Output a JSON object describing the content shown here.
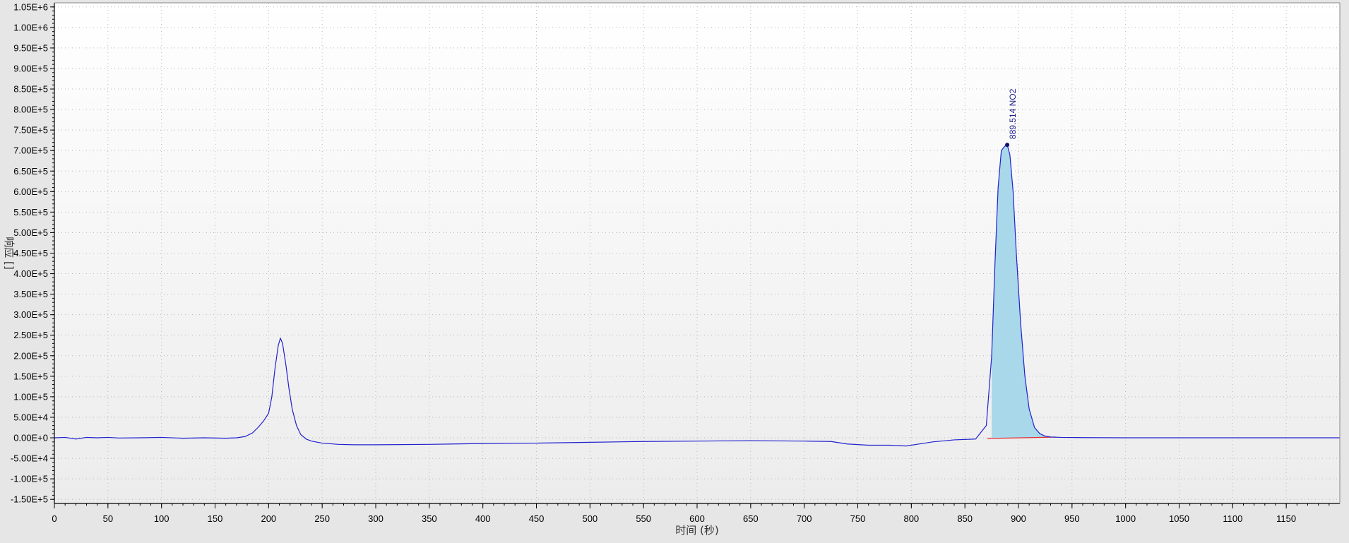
{
  "chart_data": {
    "type": "line",
    "xlabel": "时间 (秒)",
    "ylabel": "响应 []",
    "xlim": [
      0,
      1200
    ],
    "ylim": [
      -160000,
      1060000
    ],
    "x_ticks": [
      {
        "value": 0,
        "label": "0"
      },
      {
        "value": 50,
        "label": "50"
      },
      {
        "value": 100,
        "label": "100"
      },
      {
        "value": 150,
        "label": "150"
      },
      {
        "value": 200,
        "label": "200"
      },
      {
        "value": 250,
        "label": "250"
      },
      {
        "value": 300,
        "label": "300"
      },
      {
        "value": 350,
        "label": "350"
      },
      {
        "value": 400,
        "label": "400"
      },
      {
        "value": 450,
        "label": "450"
      },
      {
        "value": 500,
        "label": "500"
      },
      {
        "value": 550,
        "label": "550"
      },
      {
        "value": 600,
        "label": "600"
      },
      {
        "value": 650,
        "label": "650"
      },
      {
        "value": 700,
        "label": "700"
      },
      {
        "value": 750,
        "label": "750"
      },
      {
        "value": 800,
        "label": "800"
      },
      {
        "value": 850,
        "label": "850"
      },
      {
        "value": 900,
        "label": "900"
      },
      {
        "value": 950,
        "label": "950"
      },
      {
        "value": 1000,
        "label": "1000"
      },
      {
        "value": 1050,
        "label": "1050"
      },
      {
        "value": 1100,
        "label": "1100"
      },
      {
        "value": 1150,
        "label": "1150"
      }
    ],
    "y_ticks": [
      {
        "value": 1050000,
        "label": "1.05E+6"
      },
      {
        "value": 1000000,
        "label": "1.00E+6"
      },
      {
        "value": 950000,
        "label": "9.50E+5"
      },
      {
        "value": 900000,
        "label": "9.00E+5"
      },
      {
        "value": 850000,
        "label": "8.50E+5"
      },
      {
        "value": 800000,
        "label": "8.00E+5"
      },
      {
        "value": 750000,
        "label": "7.50E+5"
      },
      {
        "value": 700000,
        "label": "7.00E+5"
      },
      {
        "value": 650000,
        "label": "6.50E+5"
      },
      {
        "value": 600000,
        "label": "6.00E+5"
      },
      {
        "value": 550000,
        "label": "5.50E+5"
      },
      {
        "value": 500000,
        "label": "5.00E+5"
      },
      {
        "value": 450000,
        "label": "4.50E+5"
      },
      {
        "value": 400000,
        "label": "4.00E+5"
      },
      {
        "value": 350000,
        "label": "3.50E+5"
      },
      {
        "value": 300000,
        "label": "3.00E+5"
      },
      {
        "value": 250000,
        "label": "2.50E+5"
      },
      {
        "value": 200000,
        "label": "2.00E+5"
      },
      {
        "value": 150000,
        "label": "1.50E+5"
      },
      {
        "value": 100000,
        "label": "1.00E+5"
      },
      {
        "value": 50000,
        "label": "5.00E+4"
      },
      {
        "value": 0,
        "label": "0.00E+0"
      },
      {
        "value": -50000,
        "label": "-5.00E+4"
      },
      {
        "value": -100000,
        "label": "-1.00E+5"
      },
      {
        "value": -150000,
        "label": "-1.50E+5"
      }
    ],
    "grid": true,
    "series": [
      {
        "color": "#2020d0",
        "x": [
          0,
          10,
          20,
          30,
          40,
          50,
          60,
          80,
          100,
          120,
          140,
          160,
          170,
          178,
          185,
          190,
          195,
          200,
          203,
          206,
          209,
          211,
          213,
          216,
          219,
          222,
          226,
          230,
          235,
          240,
          250,
          265,
          280,
          300,
          350,
          400,
          450,
          500,
          550,
          600,
          650,
          700,
          725,
          740,
          760,
          780,
          795,
          805,
          820,
          840,
          860,
          870,
          875,
          878,
          881,
          884,
          887,
          889.5,
          892,
          895,
          898,
          902,
          906,
          910,
          915,
          920,
          925,
          930,
          940,
          960,
          1000,
          1050,
          1100,
          1150,
          1200
        ],
        "y": [
          0,
          1000,
          -3000,
          1000,
          0,
          1000,
          -500,
          0,
          1000,
          -1000,
          0,
          -1000,
          0,
          3000,
          12000,
          25000,
          40000,
          60000,
          100000,
          170000,
          225000,
          243000,
          230000,
          180000,
          120000,
          70000,
          30000,
          8000,
          -3000,
          -8000,
          -13000,
          -16000,
          -17000,
          -17000,
          -16000,
          -14000,
          -13000,
          -11000,
          -9000,
          -8000,
          -7000,
          -8000,
          -9000,
          -15000,
          -18000,
          -18000,
          -20000,
          -16000,
          -10000,
          -5000,
          -3000,
          30000,
          200000,
          420000,
          610000,
          700000,
          710000,
          714000,
          690000,
          600000,
          450000,
          280000,
          150000,
          70000,
          25000,
          10000,
          4000,
          2000,
          1000,
          500,
          0,
          0,
          0,
          0,
          0
        ]
      }
    ],
    "peaks": [
      {
        "x": 889.514,
        "y": 714000,
        "label": "889.514 NO2",
        "fill_from": 871,
        "fill_to": 935,
        "fill_color": "#a8d8ea",
        "baseline_color": "#e03030"
      }
    ]
  }
}
